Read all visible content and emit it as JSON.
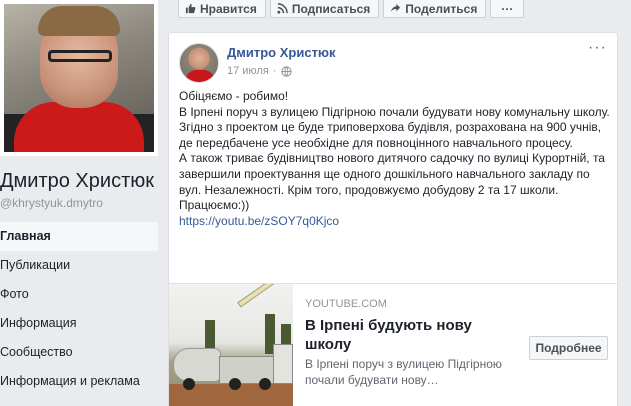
{
  "profile": {
    "name": "Дмитро Христюк",
    "handle": "@khrystyuk.dmytro",
    "photo_icon": "profile-photo"
  },
  "sidebar": {
    "items": [
      {
        "label": "Главная",
        "active": true
      },
      {
        "label": "Публикации"
      },
      {
        "label": "Фото"
      },
      {
        "label": "Информация"
      },
      {
        "label": "Сообщество"
      },
      {
        "label": "Информация и реклама"
      }
    ]
  },
  "actions": {
    "like": "Нравится",
    "follow": "Подписаться",
    "share": "Поделиться",
    "more": "···"
  },
  "post": {
    "author": "Дмитро Христюк",
    "date": "17 июля",
    "menu": "···",
    "paragraphs": [
      "Обіцяємо - робимо!",
      "В Ірпені поруч з вулицею Підгірною почали будувати нову комунальну школу. Згідно з проектом це буде триповерхова будівля, розрахована на 900 учнів, де передбачене усе необхідне для повноцінного навчального процесу.",
      "А також триває будівництво нового дитячого садочку по вулиці Курортній, та завершили проектування ще одного дошкільного навчального закладу по вул. Незалежності. Крім того, продовжуємо добудову 2 та 17 школи.",
      "Працюємо:))"
    ],
    "link": "https://youtu.be/zSOY7q0Kjco"
  },
  "preview": {
    "source": "YOUTUBE.COM",
    "title": "В Ірпені будують нову школу",
    "description": "В Ірпені поруч з вулицею Підгірною почали будувати нову…",
    "button": "Подробнее"
  },
  "colors": {
    "link": "#365899",
    "background": "#e9ebee"
  }
}
